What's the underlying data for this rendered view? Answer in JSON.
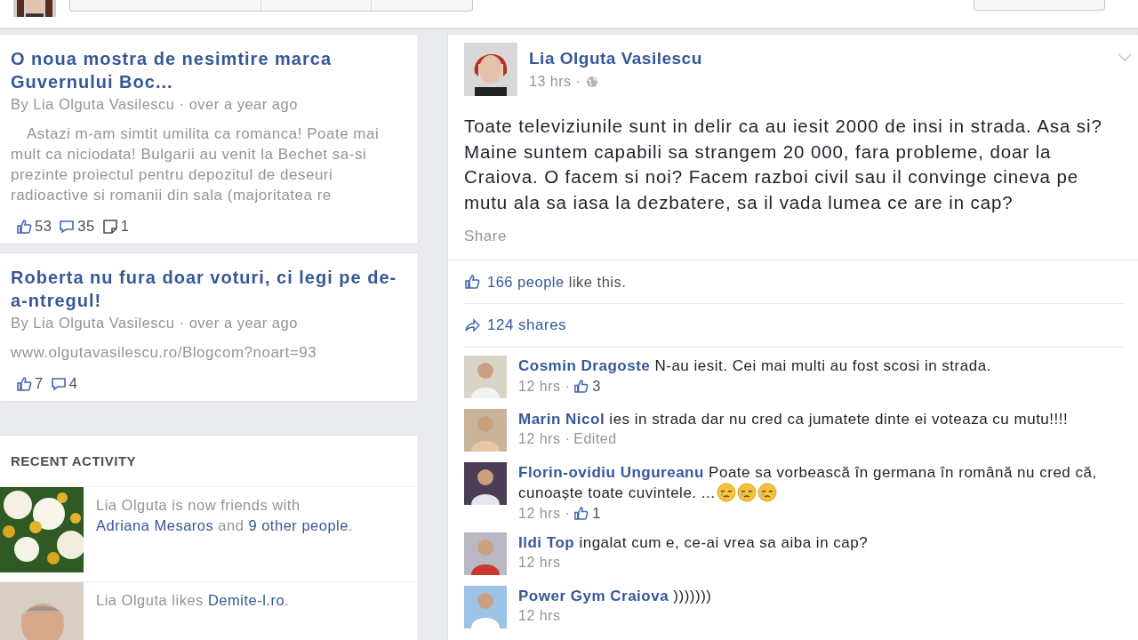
{
  "notes": [
    {
      "title": "O noua mostra de nesimtire marca Guvernului Boc...",
      "byline": "By Lia Olguta Vasilescu · over a year ago",
      "excerpt": "Astazi m-am simtit umilita ca romanca! Poate mai mult ca niciodata! Bulgarii au venit la Bechet sa-si prezinte proiectul pentru depozitul de deseuri radioactive si romanii din sala (majoritatea re",
      "stats": [
        {
          "kind": "likes",
          "count": "53"
        },
        {
          "kind": "comments",
          "count": "35"
        },
        {
          "kind": "notes",
          "count": "1"
        }
      ]
    },
    {
      "title": "Roberta nu fura doar voturi, ci legi pe de-a-ntregul!",
      "byline": "By Lia Olguta Vasilescu · over a year ago",
      "excerpt": "www.olgutavasilescu.ro/Blogcom?noart=93",
      "stats": [
        {
          "kind": "likes",
          "count": "7"
        },
        {
          "kind": "comments",
          "count": "4"
        }
      ]
    }
  ],
  "recent_activity": {
    "title": "RECENT ACTIVITY",
    "items": [
      {
        "kind": "picture",
        "parts": [
          {
            "kind": "text",
            "text": "Lia Olguta is now friends with "
          },
          {
            "kind": "link",
            "text": "Adriana Mesaros"
          },
          {
            "kind": "text",
            "text": " and "
          },
          {
            "kind": "link",
            "text": "9 other people"
          },
          {
            "kind": "text",
            "text": "."
          }
        ]
      },
      {
        "kind": "picture",
        "parts": [
          {
            "kind": "text",
            "text": "Lia Olguta likes "
          },
          {
            "kind": "link",
            "text": "Demite-l.ro"
          },
          {
            "kind": "text",
            "text": "."
          }
        ]
      }
    ]
  },
  "post": {
    "author": "Lia Olguta Vasilescu",
    "time": "13 hrs ·",
    "text": "Toate televiziunile sunt in delir ca au iesit 2000 de insi in strada. Asa si? Maine suntem capabili sa strangem 20 000, fara probleme, doar la Craiova. O facem si noi? Facem razboi civil sau il convinge cineva pe mutu ala sa iasa la dezbatere, sa il vada lumea ce are in cap?",
    "share": "Share",
    "likes_link": "166 people",
    "likes_rest": " like this.",
    "shares": "124 shares",
    "comments": [
      {
        "author": "Cosmin Dragoste",
        "text": "N-au iesit. Cei mai multi au fost scosi in strada.",
        "time": "12 hrs ·",
        "likes": "3"
      },
      {
        "author": "Marin Nicol",
        "text": "ies in strada dar nu cred ca jumatete dinte ei voteaza cu mutu!!!!",
        "time": "12 hrs ·",
        "edited": "Edited"
      },
      {
        "author": "Florin-ovidiu Ungureanu",
        "text": "Poate sa vorbească în germana în română nu cred că, cunoaște toate cuvintele. ...",
        "emojis": [
          {
            "kind": "crying"
          },
          {
            "kind": "crying"
          },
          {
            "kind": "crying"
          }
        ],
        "time": "12 hrs ·",
        "likes": "1"
      },
      {
        "author": "Ildi Top",
        "text": "ingalat cum e, ce-ai vrea sa aiba in cap?",
        "time": "12 hrs"
      },
      {
        "author": "Power Gym Craiova",
        "text": ")))))))",
        "time": "12 hrs"
      }
    ]
  }
}
